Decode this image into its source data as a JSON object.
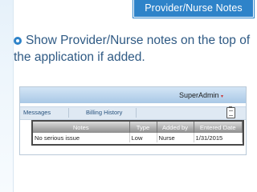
{
  "title_tab": "Provider/Nurse Notes",
  "bullet": {
    "text": "Show Provider/Nurse notes on the top of the application if added."
  },
  "screenshot": {
    "user_label": "SuperAdmin",
    "user_caret": "▾",
    "nav": {
      "messages": "Messages",
      "billing_history": "Billing History"
    },
    "notes_table": {
      "headers": {
        "notes": "Notes",
        "type": "Type",
        "added_by": "Added by",
        "entered_date": "Entered Date"
      },
      "rows": [
        {
          "notes": "No serious issue",
          "type": "Low",
          "added_by": "Nurse",
          "entered_date": "1/31/2015"
        }
      ]
    }
  },
  "colors": {
    "accent": "#2e83c9",
    "bullet_text": "#2f5a84"
  },
  "icons": {
    "bullet": "circle-bullet-icon",
    "notes": "clipboard-icon"
  }
}
